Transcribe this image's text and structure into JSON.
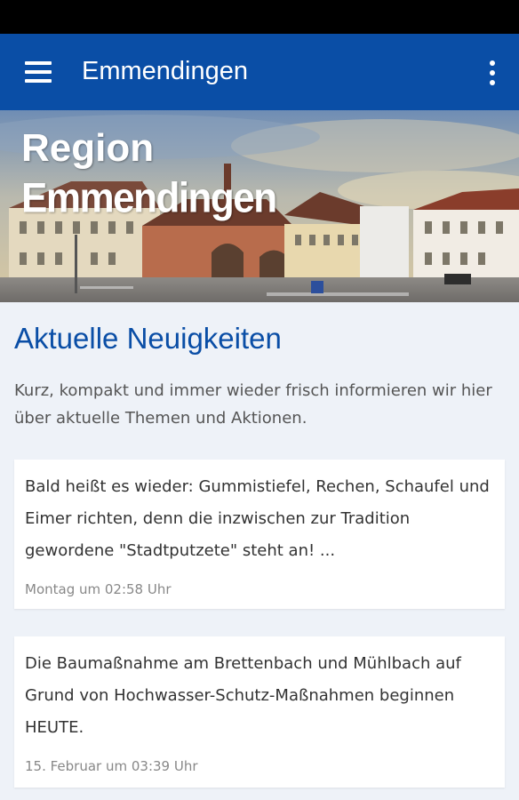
{
  "app_bar": {
    "title": "Emmendingen",
    "menu_icon": "hamburger-menu-icon",
    "overflow_icon": "more-vert-icon",
    "color": "#0a4ea6"
  },
  "hero": {
    "line1": "Region",
    "line2": "Emmendingen"
  },
  "news": {
    "title": "Aktuelle Neuigkeiten",
    "intro": "Kurz, kompakt und immer wieder frisch informieren wir hier über aktuelle Themen und Aktionen.",
    "items": [
      {
        "text": "Bald heißt es wieder: Gummistiefel, Rechen, Schaufel und Eimer richten, denn die inzwischen zur Tradition gewordene \"Stadtputzete\" steht an! ...",
        "time": "Montag um 02:58 Uhr"
      },
      {
        "text": "Die Baumaßnahme am Brettenbach und Mühlbach auf Grund von Hochwasser-Schutz-Maßnahmen beginnen HEUTE.",
        "time": "15. Februar um 03:39 Uhr"
      }
    ]
  }
}
